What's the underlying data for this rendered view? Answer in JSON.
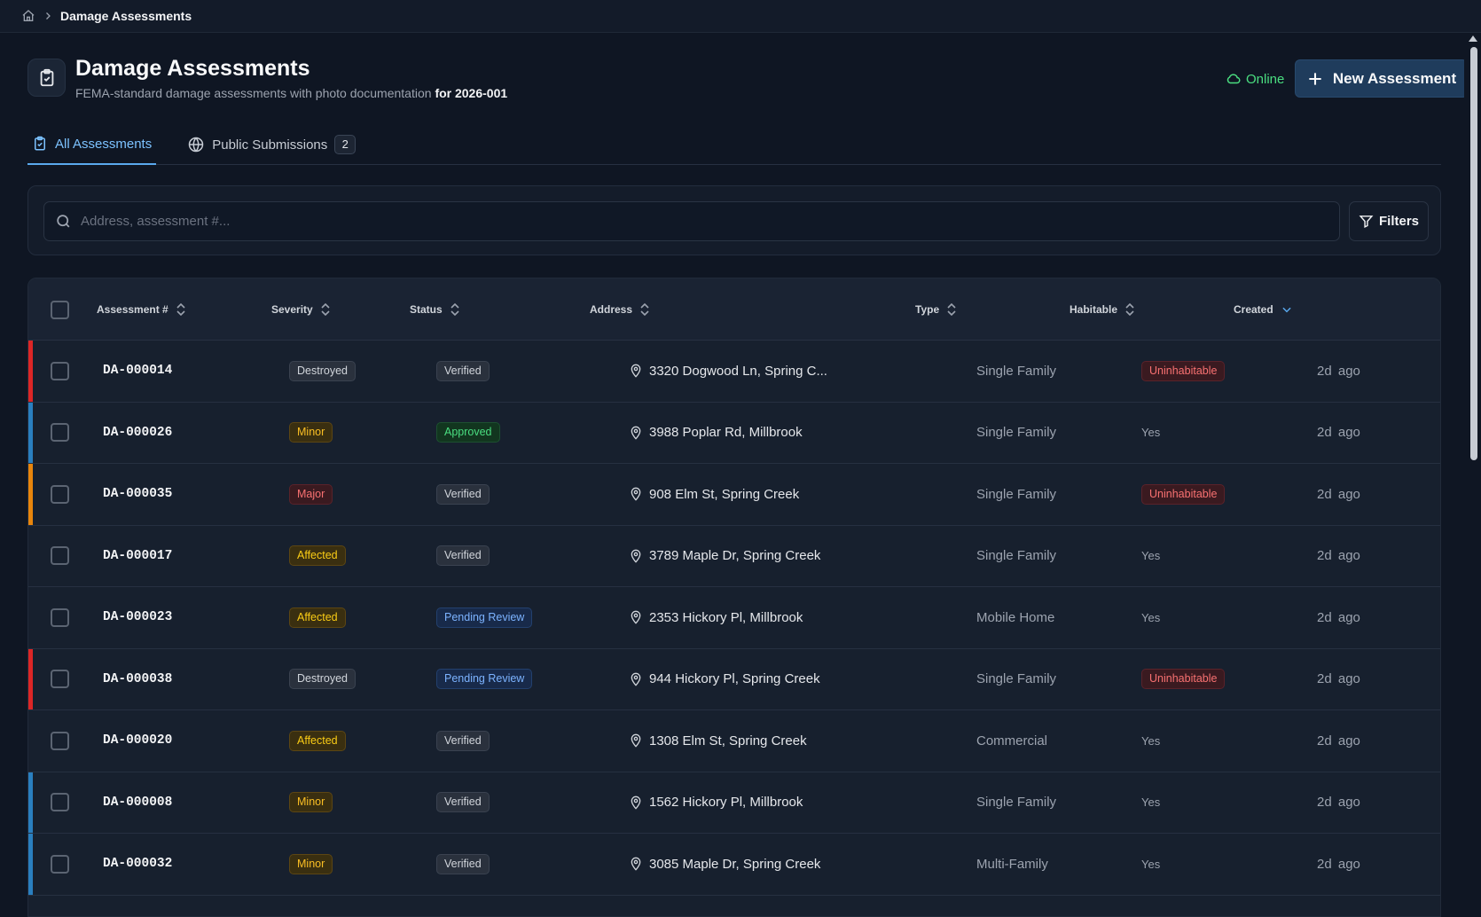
{
  "breadcrumb": {
    "current": "Damage Assessments"
  },
  "header": {
    "title": "Damage Assessments",
    "subtitle": "FEMA-standard damage assessments with photo documentation",
    "subtitle_suffix": "for 2026-001",
    "status": "Online",
    "new_button": "New Assessment"
  },
  "tabs": [
    {
      "label": "All Assessments",
      "active": true
    },
    {
      "label": "Public Submissions",
      "count": "2"
    }
  ],
  "search": {
    "placeholder": "Address, assessment #...",
    "value": ""
  },
  "filters_label": "Filters",
  "columns": {
    "assessment": "Assessment #",
    "severity": "Severity",
    "status": "Status",
    "address": "Address",
    "type": "Type",
    "habitable": "Habitable",
    "created": "Created"
  },
  "colors": {
    "destroyed": "#dc2626",
    "minor": "#2a7fbf",
    "major": "#e8850c"
  },
  "rows": [
    {
      "id": "DA-000014",
      "severity": "Destroyed",
      "status": "Verified",
      "address": "3320 Dogwood Ln, Spring C...",
      "type": "Single Family",
      "habitable": "Uninhabitable",
      "created": "2d ago"
    },
    {
      "id": "DA-000026",
      "severity": "Minor",
      "status": "Approved",
      "address": "3988 Poplar Rd, Millbrook",
      "type": "Single Family",
      "habitable": "Yes",
      "created": "2d ago"
    },
    {
      "id": "DA-000035",
      "severity": "Major",
      "status": "Verified",
      "address": "908 Elm St, Spring Creek",
      "type": "Single Family",
      "habitable": "Uninhabitable",
      "created": "2d ago"
    },
    {
      "id": "DA-000017",
      "severity": "Affected",
      "status": "Verified",
      "address": "3789 Maple Dr, Spring Creek",
      "type": "Single Family",
      "habitable": "Yes",
      "created": "2d ago"
    },
    {
      "id": "DA-000023",
      "severity": "Affected",
      "status": "Pending Review",
      "address": "2353 Hickory Pl, Millbrook",
      "type": "Mobile Home",
      "habitable": "Yes",
      "created": "2d ago"
    },
    {
      "id": "DA-000038",
      "severity": "Destroyed",
      "status": "Pending Review",
      "address": "944 Hickory Pl, Spring Creek",
      "type": "Single Family",
      "habitable": "Uninhabitable",
      "created": "2d ago"
    },
    {
      "id": "DA-000020",
      "severity": "Affected",
      "status": "Verified",
      "address": "1308 Elm St, Spring Creek",
      "type": "Commercial",
      "habitable": "Yes",
      "created": "2d ago"
    },
    {
      "id": "DA-000008",
      "severity": "Minor",
      "status": "Verified",
      "address": "1562 Hickory Pl, Millbrook",
      "type": "Single Family",
      "habitable": "Yes",
      "created": "2d ago"
    },
    {
      "id": "DA-000032",
      "severity": "Minor",
      "status": "Verified",
      "address": "3085 Maple Dr, Spring Creek",
      "type": "Multi-Family",
      "habitable": "Yes",
      "created": "2d ago"
    }
  ]
}
